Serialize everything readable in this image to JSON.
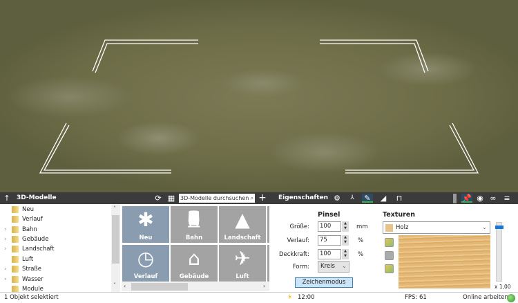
{
  "models_panel": {
    "title": "3D-Modelle",
    "search_placeholder": "3D-Modelle durchsuchen",
    "tree": [
      {
        "label": "Neu",
        "expandable": false
      },
      {
        "label": "Verlauf",
        "expandable": false
      },
      {
        "label": "Bahn",
        "expandable": true
      },
      {
        "label": "Gebäude",
        "expandable": true
      },
      {
        "label": "Landschaft",
        "expandable": true
      },
      {
        "label": "Luft",
        "expandable": false
      },
      {
        "label": "Straße",
        "expandable": true
      },
      {
        "label": "Wasser",
        "expandable": true
      },
      {
        "label": "Module",
        "expandable": false
      }
    ],
    "tiles": [
      {
        "label": "Neu",
        "icon": "asterisk-icon",
        "glyph": "✱"
      },
      {
        "label": "Bahn",
        "icon": "train-icon",
        "glyph": "🚆"
      },
      {
        "label": "Landschaft",
        "icon": "tree-icon",
        "glyph": "▲"
      },
      {
        "label": "Verlauf",
        "icon": "clock-icon",
        "glyph": "◷"
      },
      {
        "label": "Gebäude",
        "icon": "house-icon",
        "glyph": "⌂"
      },
      {
        "label": "Luft",
        "icon": "airplane-icon",
        "glyph": "✈"
      }
    ]
  },
  "properties_panel": {
    "title": "Eigenschaften",
    "brush": {
      "heading": "Pinsel",
      "size_label": "Größe:",
      "size": "100",
      "size_unit": "mm",
      "falloff_label": "Verlauf:",
      "falloff": "75",
      "falloff_unit": "%",
      "opacity_label": "Deckkraft:",
      "opacity": "100",
      "opacity_unit": "%",
      "shape_label": "Form:",
      "shape": "Kreis",
      "draw_mode_button": "Zeichenmodus"
    },
    "textures": {
      "heading": "Texturen",
      "selected": "Holz",
      "scale": "x 1,00"
    }
  },
  "status": {
    "selection": "1 Objekt selektiert",
    "time": "12:00",
    "fps": "FPS: 61",
    "online": "Online arbeiten"
  },
  "colors": {
    "toolbar": "#3b3b3b",
    "tile_active": "#8a9db0",
    "tile": "#a3a3a3",
    "active_tab_underline": "#2fb34a"
  }
}
